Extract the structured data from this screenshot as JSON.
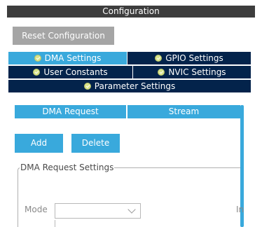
{
  "window": {
    "title": "Configuration"
  },
  "toolbar": {
    "reset_label": "Reset Configuration"
  },
  "tabs": [
    {
      "label": "DMA Settings",
      "active": true,
      "icon": "check-circle-icon"
    },
    {
      "label": "GPIO Settings",
      "active": false,
      "icon": "check-circle-icon"
    },
    {
      "label": "User Constants",
      "active": false,
      "icon": "check-circle-icon"
    },
    {
      "label": "NVIC Settings",
      "active": false,
      "icon": "check-circle-icon"
    },
    {
      "label": "Parameter Settings",
      "active": false,
      "icon": "check-circle-icon"
    }
  ],
  "table": {
    "columns": [
      "DMA Request",
      "Stream"
    ]
  },
  "actions": {
    "add_label": "Add",
    "delete_label": "Delete"
  },
  "request_settings": {
    "legend": "DMA Request Settings",
    "mode_label": "Mode",
    "mode_value": "",
    "truncated_label": "In"
  },
  "colors": {
    "title_bar": "#3d3d3d",
    "tab_inactive": "#03234b",
    "accent": "#39a9dc",
    "button_disabled": "#a5a5a5",
    "status_ok": "#d8e38a"
  }
}
